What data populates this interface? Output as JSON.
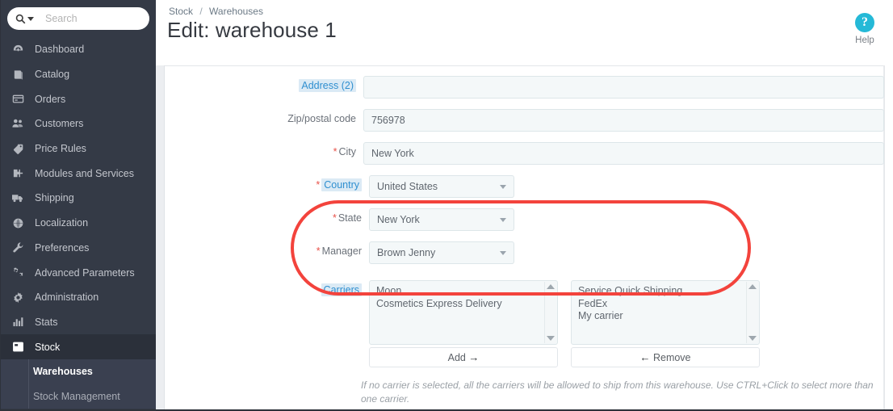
{
  "colors": {
    "sidebar_bg": "#343a46",
    "sidebar_active": "#2b303a",
    "submenu_bg": "#3a4050",
    "accent_blue": "#2f8fd0",
    "help_blue": "#25b9d7",
    "required_red": "#e8524a",
    "annotation_red": "#f3433c",
    "input_bg": "#f4f8f9"
  },
  "search": {
    "placeholder": "Search",
    "value": "",
    "icon": "search-icon",
    "caret_icon": "chevron-down-icon"
  },
  "sidebar": {
    "items": [
      {
        "label": "Dashboard",
        "icon": "dashboard-icon",
        "active": false
      },
      {
        "label": "Catalog",
        "icon": "book-icon",
        "active": false
      },
      {
        "label": "Orders",
        "icon": "card-icon",
        "active": false
      },
      {
        "label": "Customers",
        "icon": "people-icon",
        "active": false
      },
      {
        "label": "Price Rules",
        "icon": "tag-icon",
        "active": false
      },
      {
        "label": "Modules and Services",
        "icon": "puzzle-icon",
        "active": false
      },
      {
        "label": "Shipping",
        "icon": "truck-icon",
        "active": false
      },
      {
        "label": "Localization",
        "icon": "globe-icon",
        "active": false
      },
      {
        "label": "Preferences",
        "icon": "wrench-icon",
        "active": false
      },
      {
        "label": "Advanced Parameters",
        "icon": "gears-icon",
        "active": false
      },
      {
        "label": "Administration",
        "icon": "gear-icon",
        "active": false
      },
      {
        "label": "Stats",
        "icon": "bar-chart-icon",
        "active": false
      },
      {
        "label": "Stock",
        "icon": "stock-icon",
        "active": true
      }
    ],
    "submenu": [
      {
        "label": "Warehouses",
        "active": true
      },
      {
        "label": "Stock Management",
        "active": false
      }
    ]
  },
  "header": {
    "breadcrumb": {
      "parent": "Stock",
      "separator": "/",
      "current": "Warehouses"
    },
    "title": "Edit: warehouse 1",
    "help": {
      "label": "Help",
      "icon": "question-circle-icon",
      "glyph": "?"
    }
  },
  "form": {
    "address": {
      "label": "Address (2)",
      "highlighted": true,
      "required": false,
      "value": "",
      "placeholder": ""
    },
    "zip": {
      "label": "Zip/postal code",
      "highlighted": false,
      "required": false,
      "value": "756978",
      "placeholder": ""
    },
    "city": {
      "label": "City",
      "highlighted": false,
      "required": true,
      "value": "New York",
      "placeholder": ""
    },
    "country": {
      "label": "Country",
      "highlighted": true,
      "required": true,
      "value": "United States"
    },
    "state": {
      "label": "State",
      "highlighted": false,
      "required": true,
      "value": "New York"
    },
    "manager": {
      "label": "Manager",
      "highlighted": false,
      "required": true,
      "value": "Brown Jenny"
    },
    "carriers": {
      "label": "Carriers",
      "highlighted": true,
      "available": [
        "Moon",
        "Cosmetics Express Delivery"
      ],
      "selected": [
        "Service Quick Shipping",
        "FedEx",
        "My carrier"
      ],
      "add_button": {
        "label": "Add",
        "glyph": "→",
        "icon": "arrow-right-icon"
      },
      "remove_button": {
        "label": "Remove",
        "glyph": "←",
        "icon": "arrow-left-icon"
      },
      "hint": "If no carrier is selected, all the carriers will be allowed to ship from this warehouse. Use CTRL+Click to select more than one carrier."
    }
  },
  "annotation": {
    "shape": "rounded-rectangle",
    "color": "#f3433c",
    "target": "carriers-field"
  }
}
